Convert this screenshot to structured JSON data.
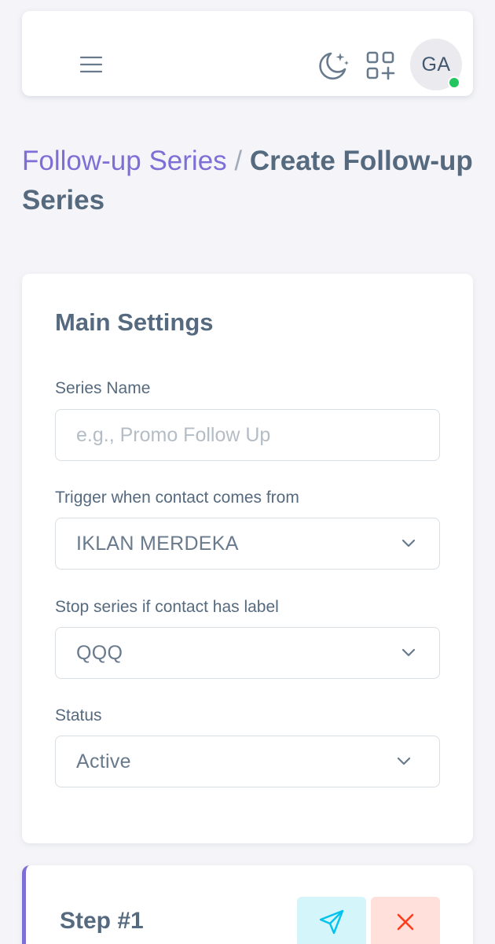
{
  "navbar": {
    "menu_icon": "hamburger-menu-icon",
    "theme_icon": "moon-stars-icon",
    "apps_icon": "grid-add-icon",
    "avatar_initials": "GA",
    "online_status_color": "#22c55e"
  },
  "breadcrumb": {
    "parent": "Follow-up Series",
    "separator": "/",
    "current": "Create Follow-up Series"
  },
  "main_settings": {
    "title": "Main Settings",
    "series_name": {
      "label": "Series Name",
      "value": "",
      "placeholder": "e.g., Promo Follow Up"
    },
    "trigger": {
      "label": "Trigger when contact comes from",
      "selected": "IKLAN MERDEKA"
    },
    "stop_label": {
      "label": "Stop series if contact has label",
      "selected": "QQQ"
    },
    "status": {
      "label": "Status",
      "selected": "Active"
    }
  },
  "step": {
    "title": "Step #1",
    "send_icon": "send-icon",
    "delete_icon": "close-icon"
  },
  "colors": {
    "accent": "#7e6fd6",
    "background": "#f5f5f9",
    "send_button_bg": "#d4f5fa",
    "send_icon": "#03c3ec",
    "delete_button_bg": "#ffe0db",
    "delete_icon": "#ff3e1d"
  }
}
